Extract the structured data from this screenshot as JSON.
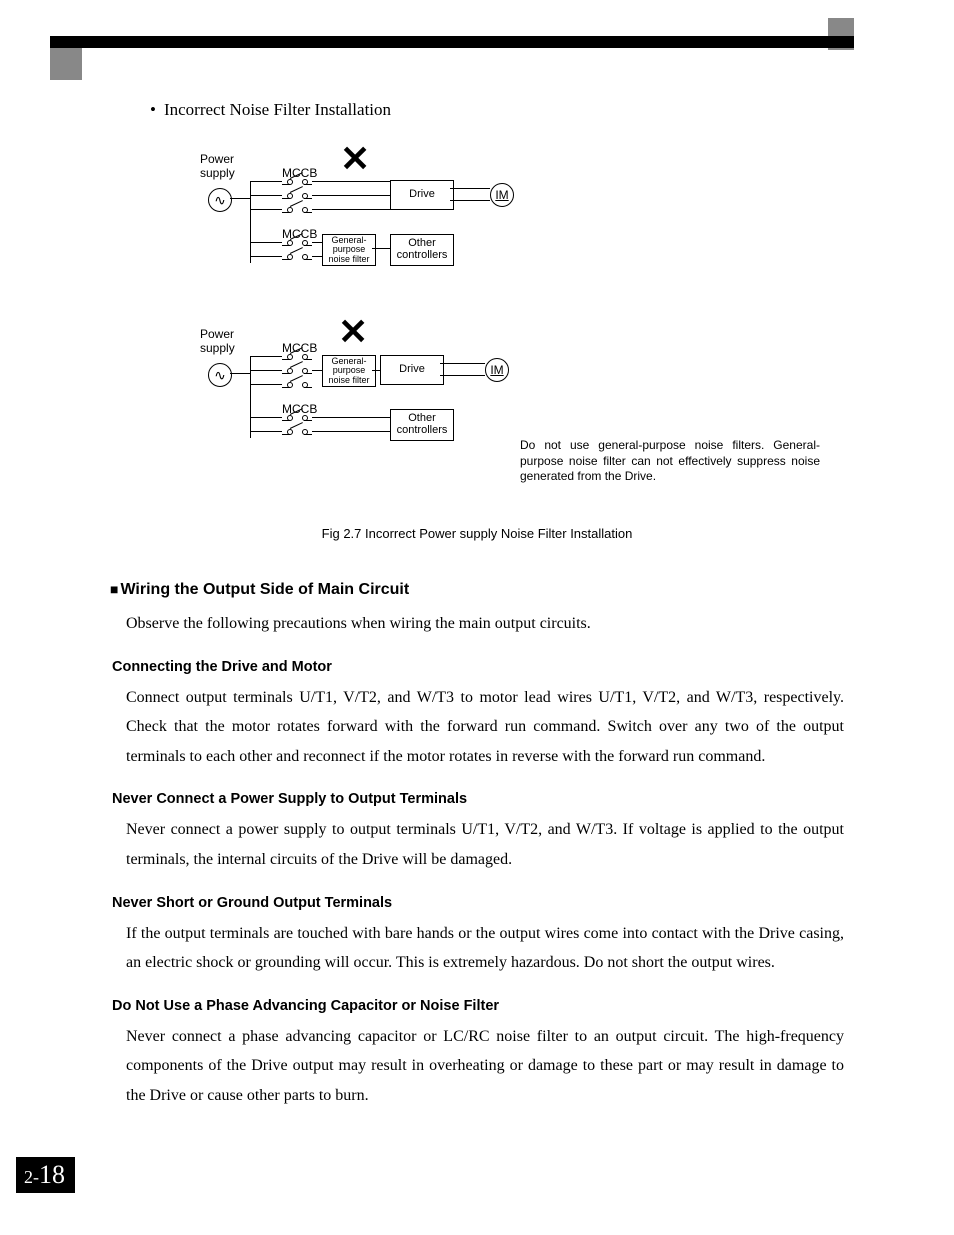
{
  "bullet": "Incorrect Noise Filter Installation",
  "figure": {
    "power_supply": "Power\nsupply",
    "mccb": "MCCB",
    "drive": "Drive",
    "im": "IM",
    "gp_filter": "General-\npurpose\nnoise filter",
    "other_ctrl": "Other\ncontrollers",
    "note": "Do not use general-purpose noise filters. General-purpose noise filter can not effectively suppress noise generated from the Drive.",
    "caption": "Fig 2.7  Incorrect Power supply Noise Filter Installation"
  },
  "section": {
    "heading": "Wiring the Output Side of Main Circuit",
    "intro": "Observe the following precautions when wiring the main output circuits.",
    "sub1": {
      "h": "Connecting the Drive and Motor",
      "p": "Connect output terminals U/T1, V/T2, and W/T3 to motor lead wires U/T1, V/T2, and W/T3, respectively. Check that the motor rotates forward with the forward run command. Switch over any two of the output terminals to each other and reconnect if the motor rotates in reverse with the forward run command."
    },
    "sub2": {
      "h": "Never Connect a Power Supply to Output Terminals",
      "p": "Never connect a power supply to output terminals U/T1, V/T2, and W/T3. If voltage is applied to the output terminals, the internal circuits of the Drive will be damaged."
    },
    "sub3": {
      "h": "Never Short or Ground Output Terminals",
      "p": "If the output terminals are touched with bare hands or the output wires come into contact with the Drive casing, an electric shock or grounding will occur. This is extremely hazardous. Do not short the output wires."
    },
    "sub4": {
      "h": "Do Not Use a Phase Advancing Capacitor or Noise Filter",
      "p": "Never connect a phase advancing capacitor or LC/RC noise filter to an output circuit. The high-frequency components of the Drive output may result in overheating or damage to these part or may result in damage to the Drive or cause other parts to burn."
    }
  },
  "pagenum": {
    "chapter": "2-",
    "page": "18"
  }
}
